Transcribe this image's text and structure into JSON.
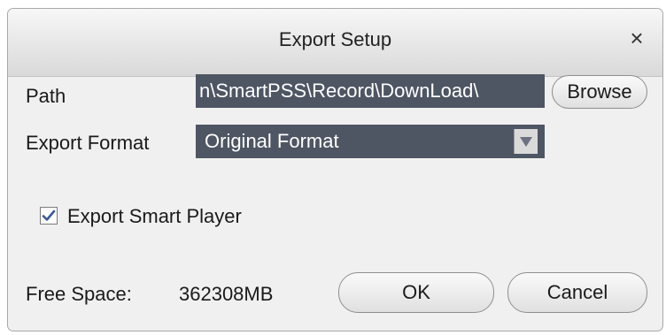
{
  "dialog": {
    "title": "Export Setup",
    "close_glyph": "×"
  },
  "path": {
    "label": "Path",
    "value": "n\\SmartPSS\\Record\\DownLoad\\",
    "browse_label": "Browse"
  },
  "format": {
    "label": "Export Format",
    "selected": "Original Format"
  },
  "smart_player": {
    "label": "Export Smart Player",
    "checked": true
  },
  "free_space": {
    "label": "Free Space:",
    "value": "362308MB"
  },
  "buttons": {
    "ok_label": "OK",
    "cancel_label": "Cancel"
  },
  "colors": {
    "field_bg": "#4e5563",
    "checkmark": "#3c5a9a"
  },
  "icons": {
    "close": "close-icon",
    "dropdown": "chevron-down-icon",
    "check": "checkmark-icon"
  }
}
